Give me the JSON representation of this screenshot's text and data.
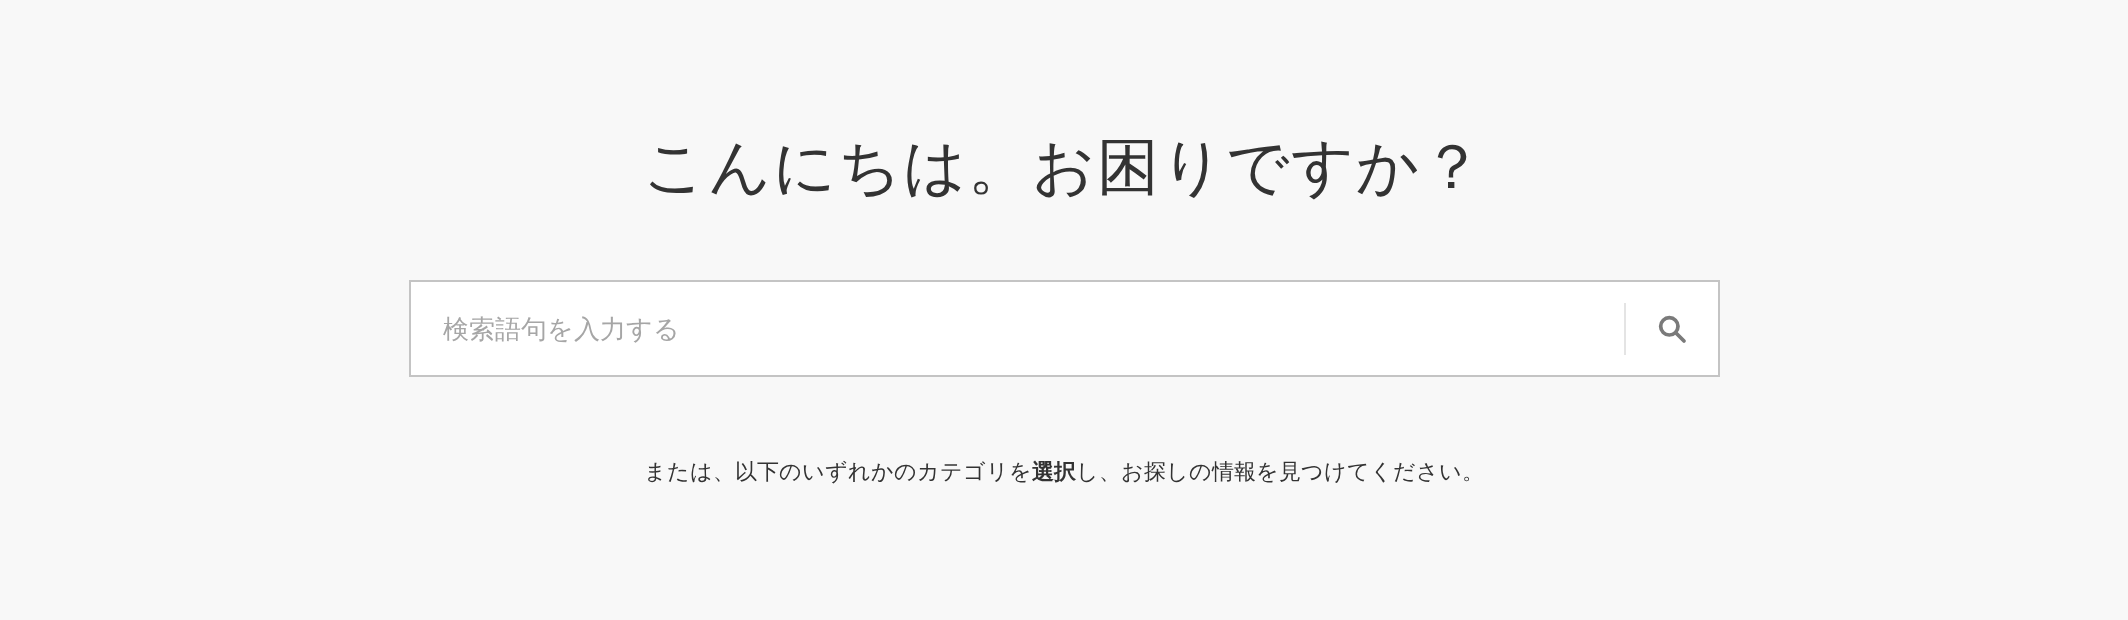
{
  "heading": "こんにちは。お困りですか？",
  "search": {
    "placeholder": "検索語句を入力する"
  },
  "hint": "または、以下のいずれかのカテゴリを**選択**し、お探しの情報を見つけてください。"
}
